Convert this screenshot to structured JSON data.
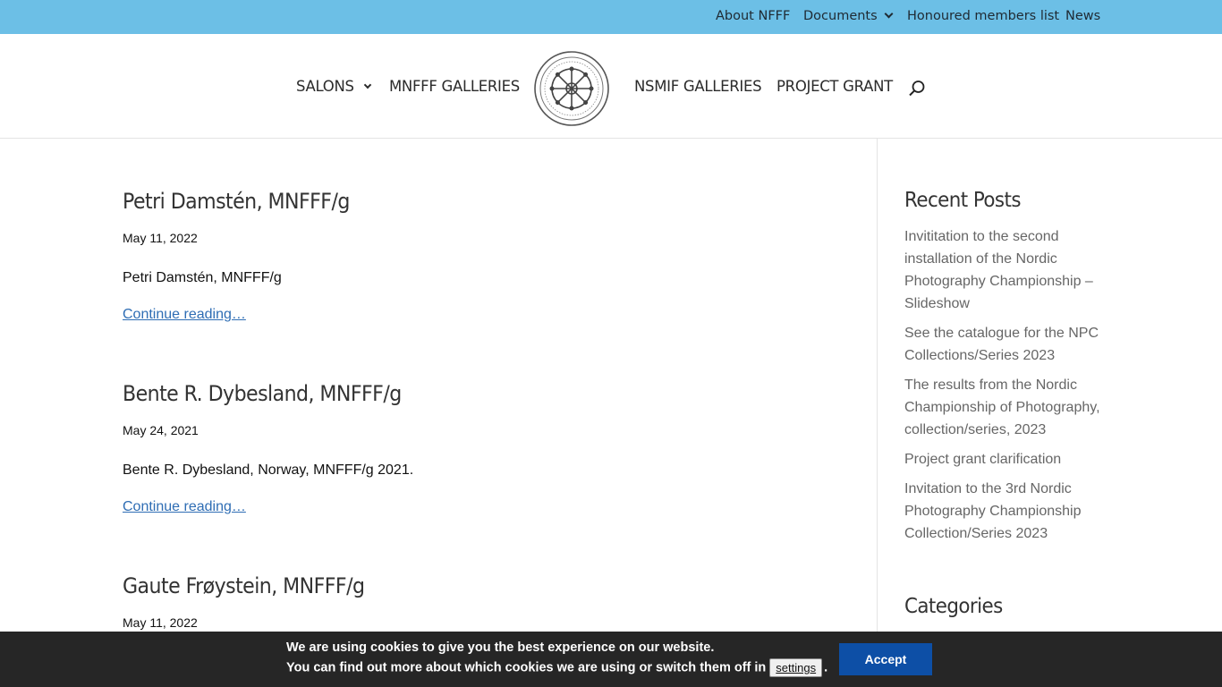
{
  "topbar": {
    "items": [
      {
        "label": "About NFFF"
      },
      {
        "label": "Documents",
        "has_dropdown": true
      },
      {
        "label": "Honoured members list"
      },
      {
        "label": "News"
      }
    ]
  },
  "nav": {
    "items": [
      {
        "label": "SALONS",
        "has_dropdown": true
      },
      {
        "label": "MNFFF GALLERIES"
      },
      {
        "label": "NSMIF GALLERIES"
      },
      {
        "label": "PROJECT GRANT"
      }
    ],
    "logo_icon": "nfff-seal-logo",
    "search_icon": "search-icon"
  },
  "posts": [
    {
      "title": "Petri Damstén, MNFFF/g",
      "date": "May 11, 2022",
      "excerpt": "Petri Damstén, MNFFF/g",
      "more": "Continue reading…"
    },
    {
      "title": "Bente R. Dybesland, MNFFF/g",
      "date": "May 24, 2021",
      "excerpt": "Bente R. Dybesland, Norway, MNFFF/g 2021.",
      "more": "Continue reading…"
    },
    {
      "title": "Gaute Frøystein, MNFFF/g",
      "date": "May 11, 2022"
    }
  ],
  "sidebar": {
    "recent_title": "Recent Posts",
    "recent_posts": [
      "Invititation to the second installation of the Nordic Photography Championship – Slideshow",
      "See the catalogue for the NPC Collections/Series 2023",
      "The results from the Nordic Championship of Photography, collection/series, 2023",
      "Project grant clarification",
      "Invitation to the 3rd Nordic Photography Championship Collection/Series 2023"
    ],
    "categories_title": "Categories"
  },
  "cookie": {
    "line1": "We are using cookies to give you the best experience on our website.",
    "line2": "You can find out more about which cookies we are using or switch them off in",
    "settings_label": "settings",
    "line2_end": ".",
    "accept_label": "Accept"
  },
  "colors": {
    "topbar_bg": "#6cbfe6",
    "link": "#2e6db4",
    "cookie_bg": "#262626",
    "accept_bg": "#0d4fa6"
  }
}
